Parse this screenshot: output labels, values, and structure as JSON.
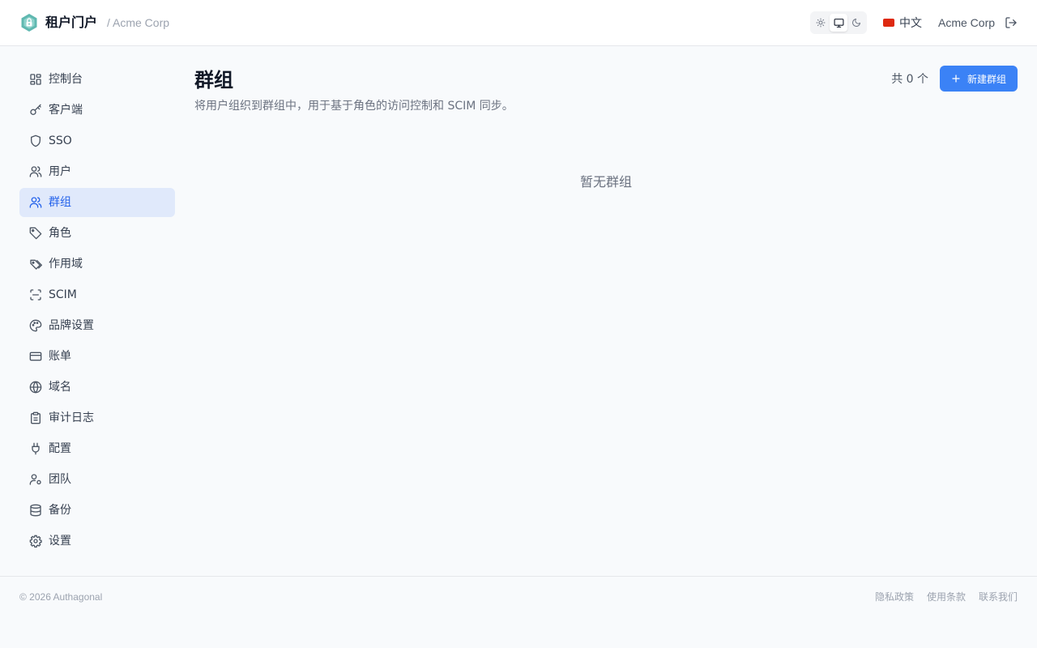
{
  "header": {
    "app_name": "租户门户",
    "org_path": "/ Acme Corp",
    "theme_modes": [
      "sun-icon",
      "monitor-icon",
      "moon-icon"
    ],
    "theme_active": "monitor-icon",
    "language": "中文",
    "tenant_name": "Acme Corp"
  },
  "sidebar": {
    "items": [
      {
        "label": "控制台",
        "icon": "dashboard-icon"
      },
      {
        "label": "客户端",
        "icon": "key-icon"
      },
      {
        "label": "SSO",
        "icon": "shield-icon"
      },
      {
        "label": "用户",
        "icon": "users-icon"
      },
      {
        "label": "群组",
        "icon": "users-icon",
        "active": true
      },
      {
        "label": "角色",
        "icon": "tag-icon"
      },
      {
        "label": "作用域",
        "icon": "tags-icon"
      },
      {
        "label": "SCIM",
        "icon": "scan-icon"
      },
      {
        "label": "品牌设置",
        "icon": "palette-icon"
      },
      {
        "label": "账单",
        "icon": "credit-card-icon"
      },
      {
        "label": "域名",
        "icon": "globe-icon"
      },
      {
        "label": "审计日志",
        "icon": "clipboard-icon"
      },
      {
        "label": "配置",
        "icon": "plug-icon"
      },
      {
        "label": "团队",
        "icon": "user-cog-icon"
      },
      {
        "label": "备份",
        "icon": "database-icon"
      },
      {
        "label": "设置",
        "icon": "gear-icon"
      }
    ]
  },
  "main": {
    "title": "群组",
    "description": "将用户组织到群组中，用于基于角色的访问控制和 SCIM 同步。",
    "count_text": "共 0 个",
    "new_button_label": "新建群组",
    "empty_text": "暂无群组"
  },
  "footer": {
    "copyright": "© 2026 Authagonal",
    "links": [
      "隐私政策",
      "使用条款",
      "联系我们"
    ]
  },
  "colors": {
    "accent": "#3b82f6",
    "active_bg": "#e0e9fb",
    "active_text": "#2563eb",
    "logo": "#5fb8b0"
  }
}
